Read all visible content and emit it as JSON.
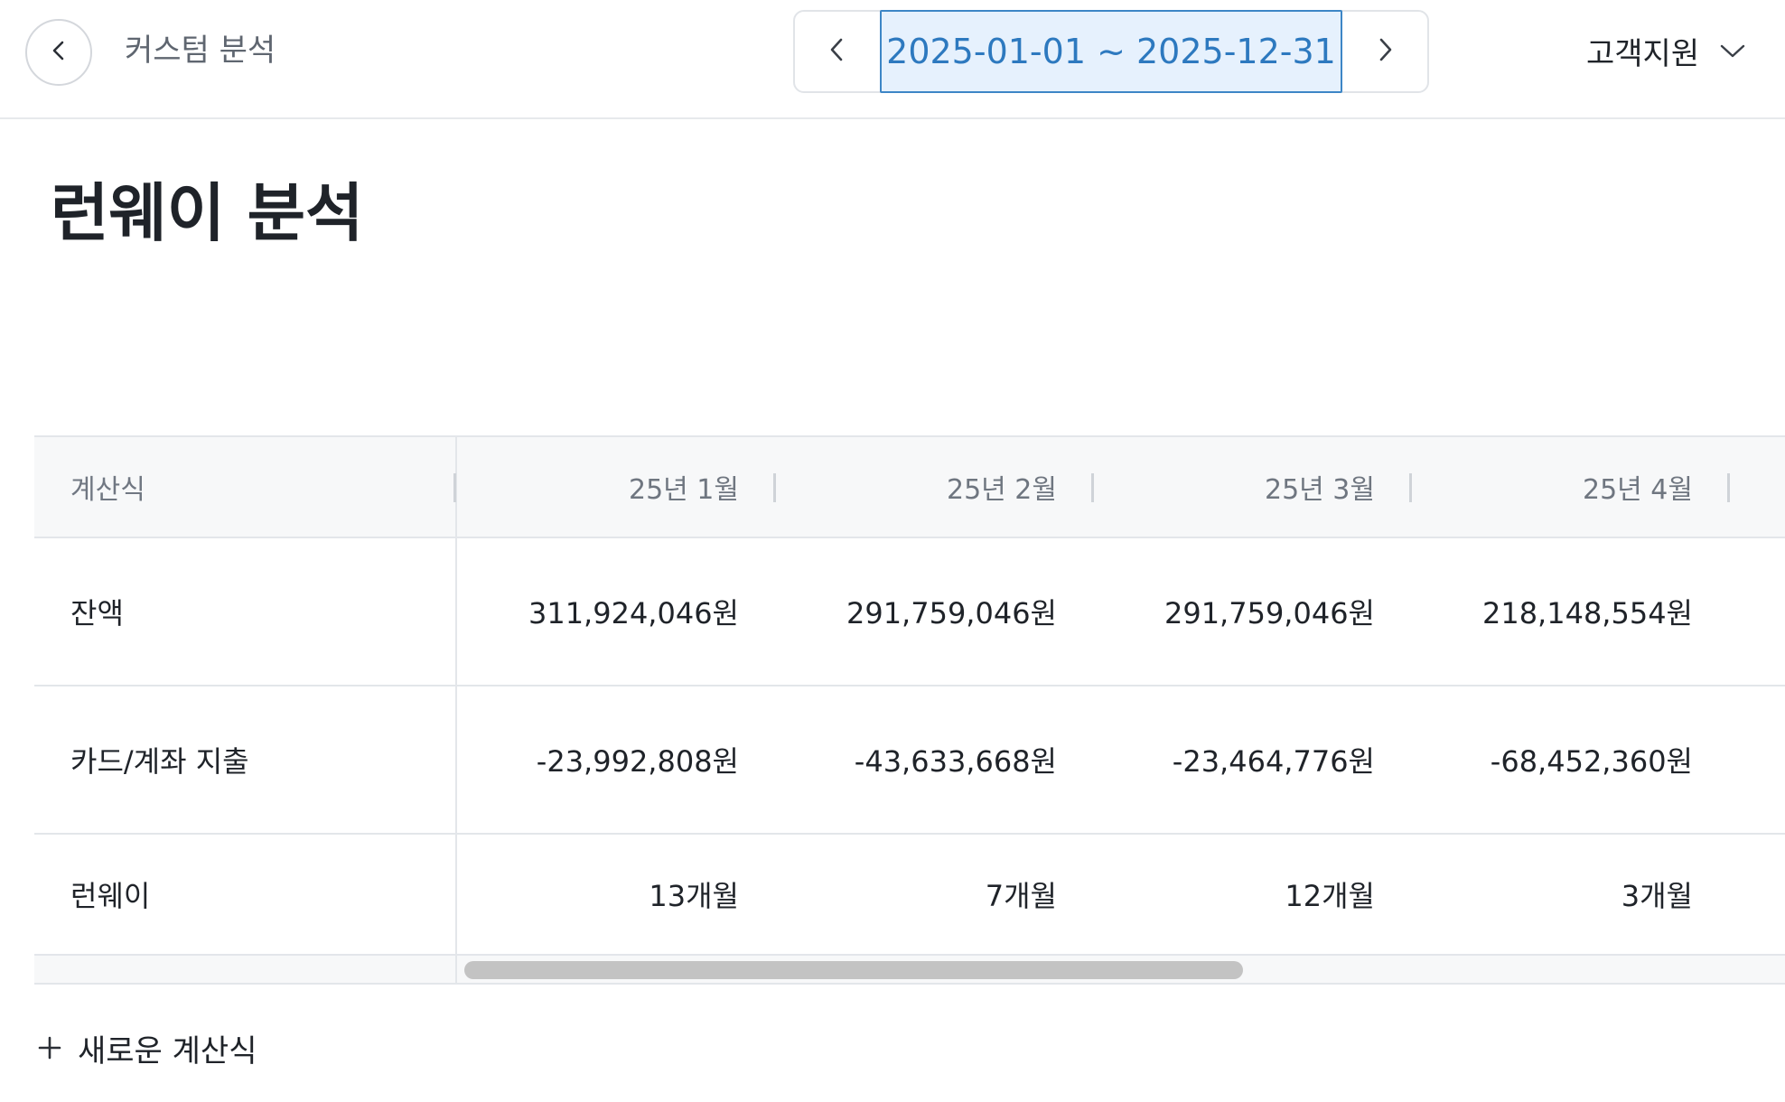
{
  "header": {
    "title": "커스텀 분석",
    "date_range": "2025-01-01 ~ 2025-12-31",
    "support_label": "고객지원"
  },
  "page": {
    "title": "런웨이 분석"
  },
  "table": {
    "label_header": "계산식",
    "columns": [
      "25년 1월",
      "25년 2월",
      "25년 3월",
      "25년 4월"
    ],
    "rows": [
      {
        "label": "잔액",
        "values": [
          "311,924,046원",
          "291,759,046원",
          "291,759,046원",
          "218,148,554원"
        ]
      },
      {
        "label": "카드/계좌 지출",
        "values": [
          "-23,992,808원",
          "-43,633,668원",
          "-23,464,776원",
          "-68,452,360원"
        ]
      },
      {
        "label": "런웨이",
        "values": [
          "13개월",
          "7개월",
          "12개월",
          "3개월"
        ]
      }
    ]
  },
  "actions": {
    "add_formula": "새로운 계산식"
  },
  "icons": {
    "back": "chevron-left-icon",
    "prev": "chevron-left-icon",
    "next": "chevron-right-icon",
    "dropdown": "chevron-down-icon",
    "add": "plus-icon"
  },
  "colors": {
    "accent": "#2d79bf",
    "accent_bg": "#e6f1fd",
    "text": "#1f2329",
    "muted": "#6f7680"
  }
}
